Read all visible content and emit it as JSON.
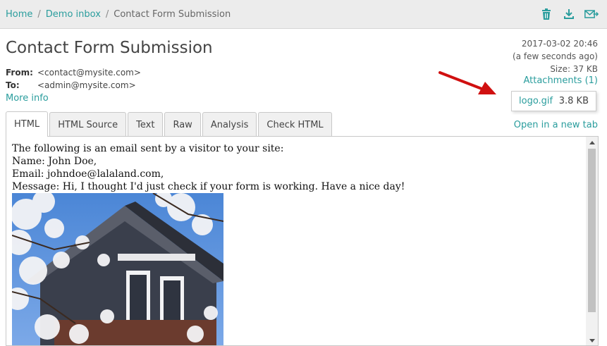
{
  "breadcrumb": {
    "home": "Home",
    "inbox": "Demo inbox",
    "current": "Contact Form Submission",
    "separator": "/"
  },
  "toolbar": {
    "icons": [
      "trash-icon",
      "download-icon",
      "forward-icon"
    ],
    "accent": "#2a9d9d"
  },
  "message": {
    "subject": "Contact Form Submission",
    "from_label": "From:",
    "from_value": "<contact@mysite.com>",
    "to_label": "To:",
    "to_value": "<admin@mysite.com>",
    "more_info": "More info",
    "date": "2017-03-02 20:46",
    "relative_time": "(a few seconds ago)",
    "size": "Size: 37 KB",
    "attachments_link": "Attachments (1)",
    "attachment": {
      "name": "logo.gif",
      "size": "3.8 KB"
    }
  },
  "tabs": [
    {
      "label": "HTML",
      "active": true
    },
    {
      "label": "HTML Source",
      "active": false
    },
    {
      "label": "Text",
      "active": false
    },
    {
      "label": "Raw",
      "active": false
    },
    {
      "label": "Analysis",
      "active": false
    },
    {
      "label": "Check HTML",
      "active": false
    }
  ],
  "open_new_tab": "Open in a new tab",
  "email_body": {
    "lines": [
      "The following is an email sent by a visitor to your site:",
      "Name: John Doe,",
      "Email: johndoe@lalaland.com,",
      "Message: Hi, I thought I'd just check if your form is working. Have a nice day!"
    ]
  },
  "colors": {
    "annotation_arrow": "#d01010"
  }
}
